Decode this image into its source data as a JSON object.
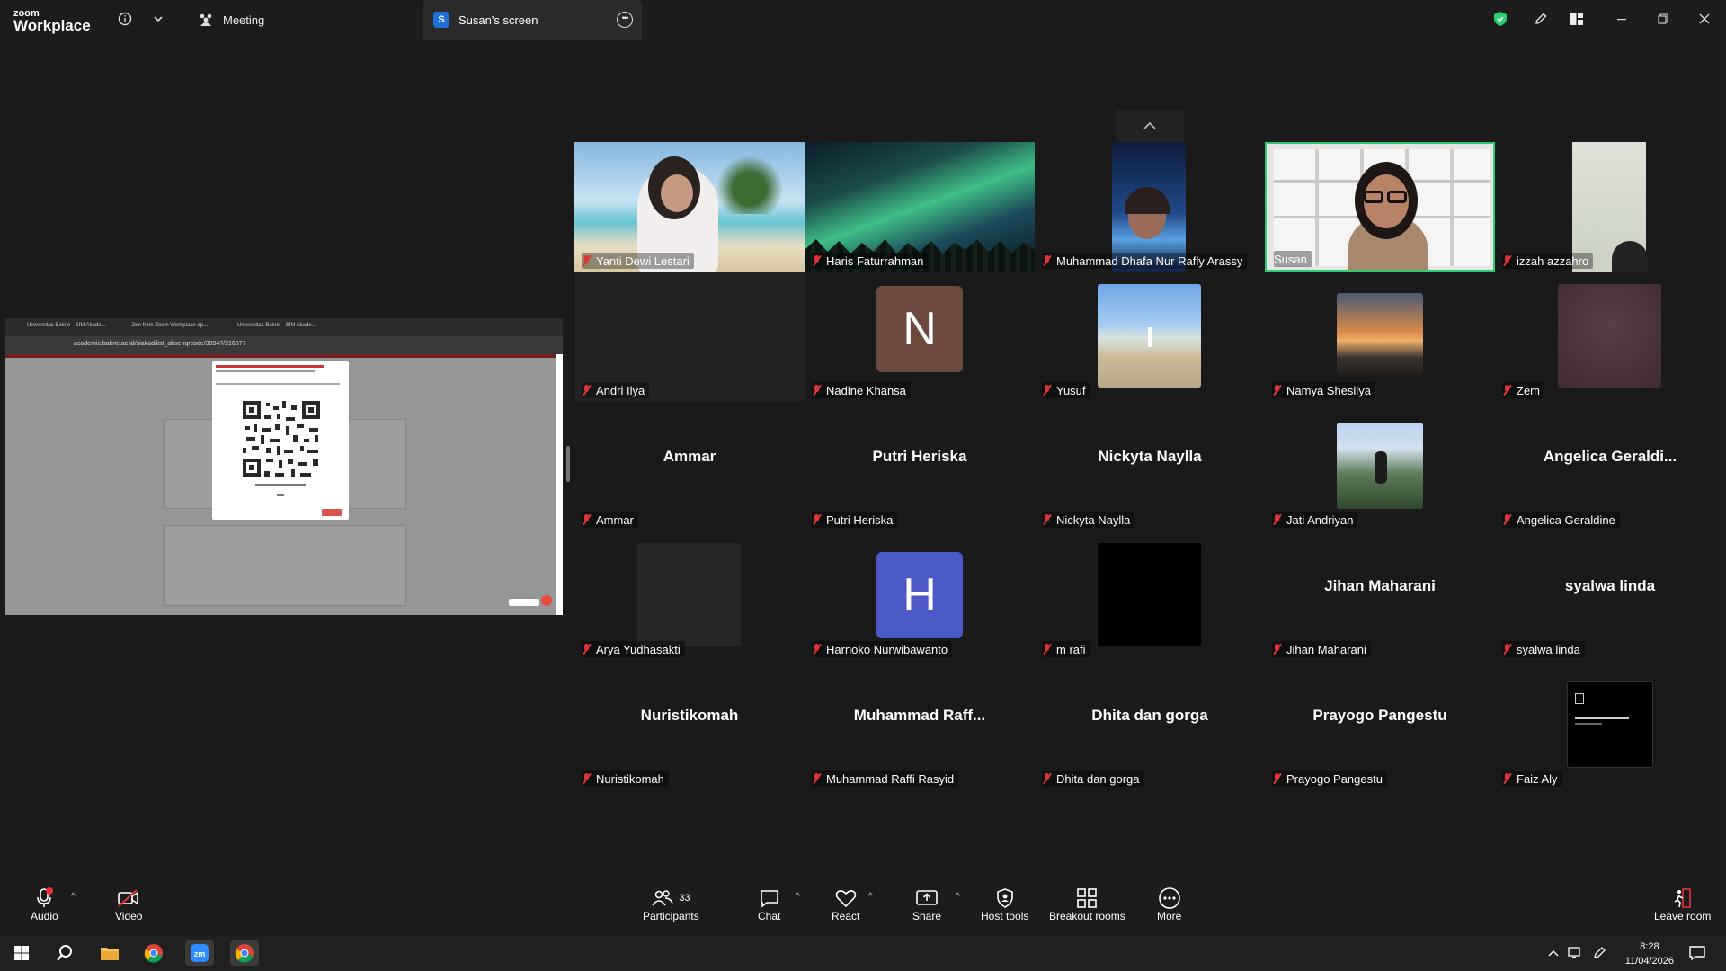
{
  "window": {
    "logo_top": "zoom",
    "logo_bottom": "Workplace",
    "meeting_tab": "Meeting",
    "screen_tab_letter": "S",
    "screen_tab": "Susan's screen"
  },
  "shared_screen": {
    "url": "academic.bakrie.ac.id/siakad/list_absenqrcode/38947/216877",
    "tabs": [
      "Universitas Bakrie - SIM Akade...",
      "Join from Zoom Workplace ap...",
      "Universitas Bakrie - SIM Akade..."
    ]
  },
  "participants_grid": [
    {
      "name": "Yanti Dewi Lestari",
      "kind": "video"
    },
    {
      "name": "Haris Faturrahman",
      "kind": "video"
    },
    {
      "name": "Muhammad Dhafa Nur Rafly Arassy",
      "kind": "video"
    },
    {
      "name": "Susan",
      "kind": "video",
      "active_speaker": true
    },
    {
      "name": "izzah azzahro",
      "kind": "video"
    },
    {
      "name": "Andri Ilya",
      "kind": "blank"
    },
    {
      "name": "Nadine Khansa",
      "kind": "letter",
      "letter": "N",
      "color": "#6e4a3e"
    },
    {
      "name": "Yusuf",
      "kind": "photo"
    },
    {
      "name": "Namya Shesilya",
      "kind": "photo"
    },
    {
      "name": "Zem",
      "kind": "photo"
    },
    {
      "name": "Ammar",
      "kind": "text",
      "display": "Ammar"
    },
    {
      "name": "Putri Heriska",
      "kind": "text",
      "display": "Putri Heriska"
    },
    {
      "name": "Nickyta Naylla",
      "kind": "text",
      "display": "Nickyta Naylla"
    },
    {
      "name": "Jati Andriyan",
      "kind": "photo"
    },
    {
      "name": "Angelica Geraldine",
      "kind": "text",
      "display": "Angelica  Geraldi..."
    },
    {
      "name": "Arya Yudhasakti",
      "kind": "photo"
    },
    {
      "name": "Harnoko Nurwibawanto",
      "kind": "letter",
      "letter": "H",
      "color": "#4c58c6"
    },
    {
      "name": "m rafi",
      "kind": "photo"
    },
    {
      "name": "Jihan Maharani",
      "kind": "text",
      "display": "Jihan Maharani"
    },
    {
      "name": "syalwa linda",
      "kind": "text",
      "display": "syalwa linda"
    },
    {
      "name": "Nuristikomah",
      "kind": "text",
      "display": "Nuristikomah"
    },
    {
      "name": "Muhammad Raffi Rasyid",
      "kind": "text",
      "display": "Muhammad  Raff..."
    },
    {
      "name": "Dhita dan gorga",
      "kind": "text",
      "display": "Dhita dan gorga"
    },
    {
      "name": "Prayogo Pangestu",
      "kind": "text",
      "display": "Prayogo Pangestu"
    },
    {
      "name": "Faiz Aly",
      "kind": "photo"
    }
  ],
  "toolbar": {
    "audio": "Audio",
    "video": "Video",
    "participants": "Participants",
    "participants_count": "33",
    "chat": "Chat",
    "react": "React",
    "share": "Share",
    "host_tools": "Host tools",
    "breakout_rooms": "Breakout rooms",
    "more": "More",
    "leave": "Leave room"
  },
  "taskbar": {
    "time": "8:28",
    "date": "11/04/2026"
  },
  "colors": {
    "active_speaker": "#2ecc71",
    "mute": "#e03535",
    "brand_blue": "#1e6fd9"
  }
}
